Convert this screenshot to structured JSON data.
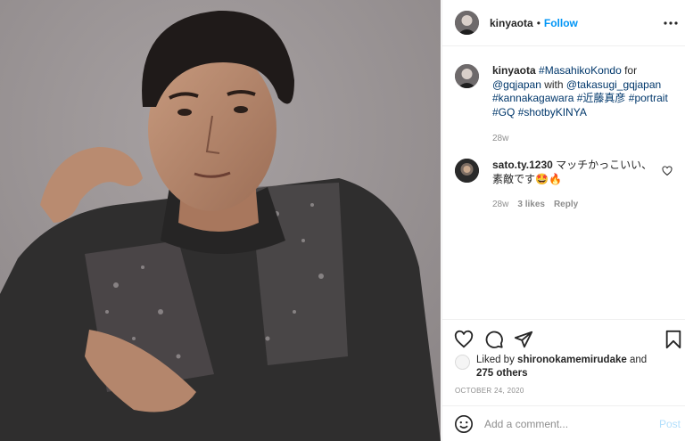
{
  "post": {
    "author": "kinyaota",
    "dot": "•",
    "follow_label": "Follow",
    "more_icon": "more-horizontal-icon"
  },
  "caption": {
    "username": "kinyaota",
    "parts": [
      {
        "text": "#MasahikoKondo",
        "tag": true
      },
      {
        "text": " for ",
        "tag": false
      },
      {
        "text": "@gqjapan",
        "tag": true
      },
      {
        "text": " with ",
        "tag": false
      },
      {
        "text": "@takasugi_gqjapan",
        "tag": true
      },
      {
        "text": " ",
        "tag": false
      },
      {
        "text": "#kannakagawara",
        "tag": true
      },
      {
        "text": " ",
        "tag": false
      },
      {
        "text": "#近藤真彦",
        "tag": true
      },
      {
        "text": " ",
        "tag": false
      },
      {
        "text": "#portrait",
        "tag": true
      },
      {
        "text": " ",
        "tag": false
      },
      {
        "text": "#GQ",
        "tag": true
      },
      {
        "text": " ",
        "tag": false
      },
      {
        "text": "#shotbyKINYA",
        "tag": true
      }
    ],
    "time": "28w"
  },
  "comment": {
    "username": "sato.ty.1230",
    "text": "マッチかっこいい、素敵です🤩🔥",
    "time": "28w",
    "likes": "3 likes",
    "reply": "Reply"
  },
  "likes": {
    "prefix": "Liked by",
    "user": "shironokamemirudake",
    "joiner": "and",
    "others": "275 others"
  },
  "date": "OCTOBER 24, 2020",
  "add_comment": {
    "placeholder": "Add a comment...",
    "post_label": "Post"
  },
  "colors": {
    "link": "#0095f6",
    "hashtag": "#00376b",
    "muted": "#8e8e8e",
    "photo_background": "#9b9596"
  }
}
